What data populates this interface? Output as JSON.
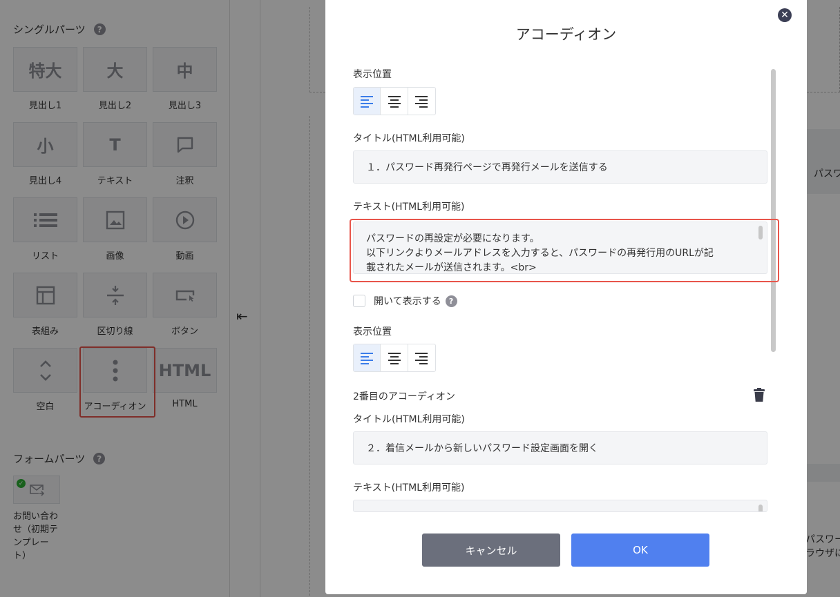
{
  "left_panel": {
    "single_parts_title": "シングルパーツ",
    "form_parts_title": "フォームパーツ",
    "help_glyph": "?",
    "parts": [
      {
        "label": "見出し1",
        "glyph": "特大"
      },
      {
        "label": "見出し2",
        "glyph": "大"
      },
      {
        "label": "見出し3",
        "glyph": "中"
      },
      {
        "label": "見出し4",
        "glyph": "小"
      },
      {
        "label": "テキスト",
        "glyph": "T"
      },
      {
        "label": "注釈",
        "icon": "speech-bubble-icon"
      },
      {
        "label": "リスト",
        "icon": "list-icon"
      },
      {
        "label": "画像",
        "icon": "image-icon"
      },
      {
        "label": "動画",
        "icon": "play-icon"
      },
      {
        "label": "表組み",
        "icon": "table-icon"
      },
      {
        "label": "区切り線",
        "icon": "divider-icon"
      },
      {
        "label": "ボタン",
        "icon": "button-icon"
      },
      {
        "label": "空白",
        "icon": "spacing-icon"
      },
      {
        "label": "アコーディオン",
        "icon": "vertical-dots-icon"
      },
      {
        "label": "HTML",
        "glyph": "HTML"
      }
    ],
    "form_item": {
      "label": "お問い合わせ（初期テンプレート）",
      "icon": "mail-icon"
    }
  },
  "canvas": {
    "collapse_icon": "⇤",
    "right_text_1": "パスワ",
    "right_text_2a": "パスワー",
    "right_text_2b": "ラウザに"
  },
  "modal": {
    "title": "アコーディオン",
    "close_glyph": "✕",
    "position_label_1": "表示位置",
    "title_label_1": "タイトル(HTML利用可能)",
    "title_value_1": "１．パスワード再発行ページで再発行メールを送信する",
    "text_label_1": "テキスト(HTML利用可能)",
    "text_lines_1": [
      "パスワードの再設定が必要になります。",
      "以下リンクよりメールアドレスを入力すると、パスワードの再発行用のURLが記",
      "載されたメールが送信されます。<br>"
    ],
    "open_checkbox_label": "開いて表示する",
    "position_label_2": "表示位置",
    "second_accordion_label": "2番目のアコーディオン",
    "title_label_2": "タイトル(HTML利用可能)",
    "title_value_2": "２．着信メールから新しいパスワード設定画面を開く",
    "text_label_2": "テキスト(HTML利用可能)",
    "cancel_label": "キャンセル",
    "ok_label": "OK"
  },
  "colors": {
    "accent": "#5080ef",
    "highlight": "#e8554b",
    "cancel": "#6b6f7c",
    "check": "#2eb135"
  }
}
